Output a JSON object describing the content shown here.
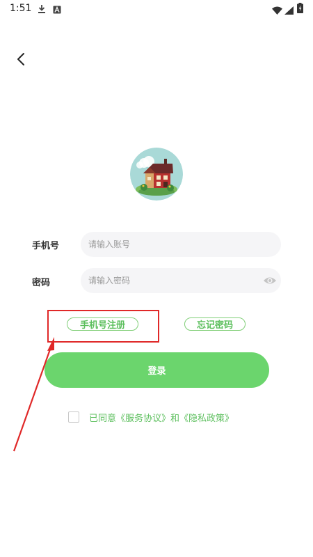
{
  "status_bar": {
    "time": "1:51",
    "icons": [
      "download-icon",
      "a-notification-icon",
      "wifi-icon",
      "signal-icon",
      "battery-icon"
    ]
  },
  "header": {
    "back_icon": "chevron-left-icon"
  },
  "logo": {
    "icon": "house-logo-icon"
  },
  "form": {
    "phone_label": "手机号",
    "phone_placeholder": "请输入账号",
    "password_label": "密码",
    "password_placeholder": "请输入密码",
    "password_toggle_icon": "eye-icon"
  },
  "links": {
    "register": "手机号注册",
    "forgot": "忘记密码"
  },
  "login_button": "登录",
  "agreement": {
    "text": "已同意《服务协议》和《隐私政策》",
    "checked": false
  },
  "colors": {
    "accent": "#6bd56d",
    "link_text": "#5cbf5d",
    "annotation": "#e02828",
    "field_bg": "#f5f5f7"
  }
}
